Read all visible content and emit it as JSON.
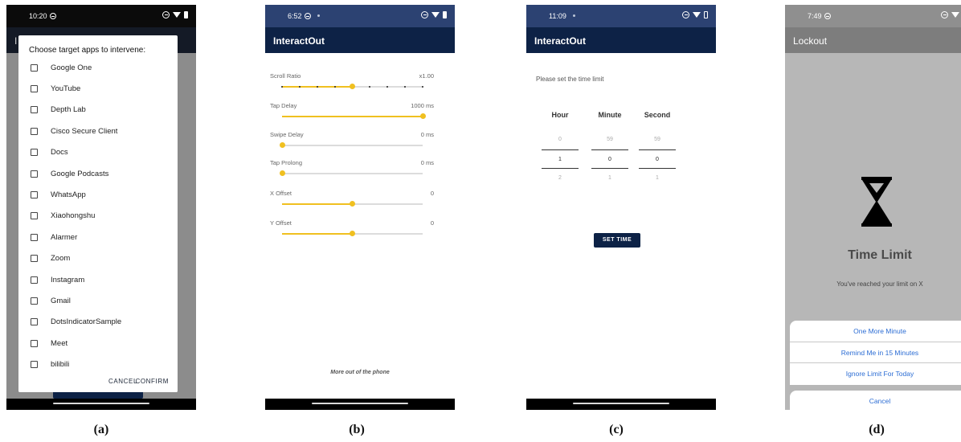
{
  "panels": {
    "a": {
      "caption": "(a)",
      "status_time": "10:20",
      "background_label": "I",
      "dialog_title": "Choose target apps to intervene:",
      "apps": [
        "Google One",
        "YouTube",
        "Depth Lab",
        "Cisco Secure Client",
        "Docs",
        "Google Podcasts",
        "WhatsApp",
        "Xiaohongshu",
        "Alarmer",
        "Zoom",
        "Instagram",
        "Gmail",
        "DotsIndicatorSample",
        "Meet",
        "bilibili"
      ],
      "cancel_label": "CANCEL",
      "confirm_label": "CONFIRM"
    },
    "b": {
      "caption": "(b)",
      "status_time": "6:52",
      "app_title": "InteractOut",
      "settings": [
        {
          "label": "Scroll Ratio",
          "value": "x1.00",
          "level": 0.5
        },
        {
          "label": "Tap Delay",
          "value": "1000 ms",
          "level": 1.0
        },
        {
          "label": "Swipe Delay",
          "value": "0 ms",
          "level": 0.0
        },
        {
          "label": "Tap Prolong",
          "value": "0 ms",
          "level": 0.0
        },
        {
          "label": "X Offset",
          "value": "0",
          "level": 0.5
        },
        {
          "label": "Y Offset",
          "value": "0",
          "level": 0.5
        }
      ],
      "footer": "More out of the phone"
    },
    "c": {
      "caption": "(c)",
      "status_time": "11:09",
      "app_title": "InteractOut",
      "prompt": "Please set the time limit",
      "columns": [
        {
          "header": "Hour",
          "above": "0",
          "selected": "1",
          "below": "2"
        },
        {
          "header": "Minute",
          "above": "59",
          "selected": "0",
          "below": "1"
        },
        {
          "header": "Second",
          "above": "59",
          "selected": "0",
          "below": "1"
        }
      ],
      "set_time_label": "SET TIME"
    },
    "d": {
      "caption": "(d)",
      "status_time": "7:49",
      "app_title": "Lockout",
      "limit_title": "Time Limit",
      "limit_message": "You've reached your limit on X",
      "options": [
        "One More Minute",
        "Remind Me in 15 Minutes",
        "Ignore Limit For Today"
      ],
      "cancel_label": "Cancel"
    }
  },
  "colors": {
    "app_bar": "#0d2246",
    "accent_yellow": "#f0c020",
    "link_blue": "#2c6dd4"
  }
}
